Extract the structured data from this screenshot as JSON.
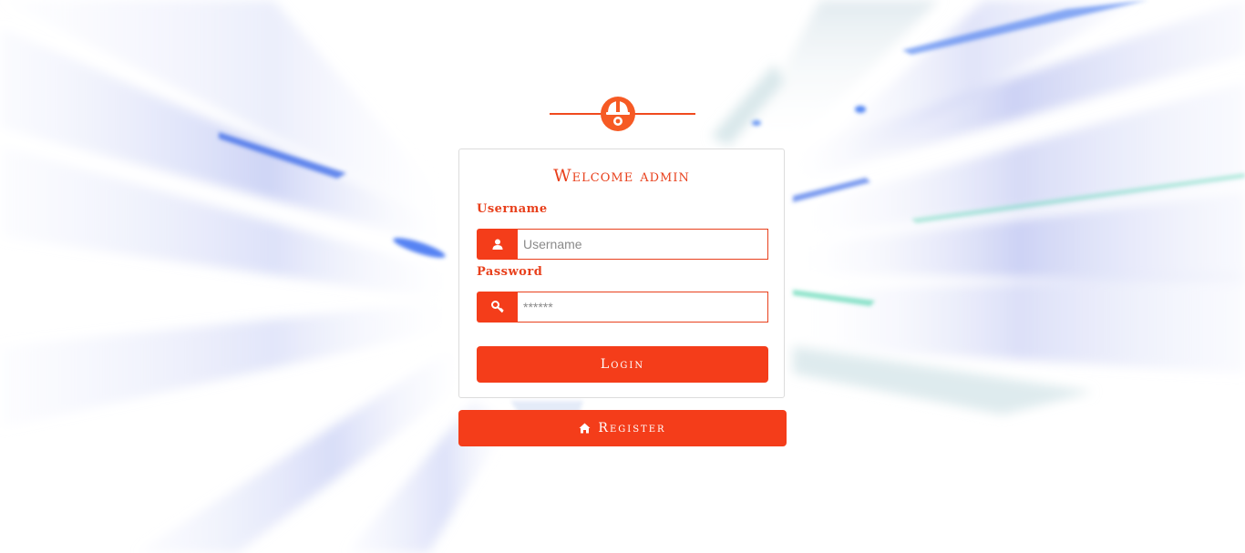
{
  "colors": {
    "accent": "#f43d1a",
    "accent_text": "#e8401c"
  },
  "header": {
    "logo_icon": "helmet-gear-icon"
  },
  "login_card": {
    "title": "Welcome admin",
    "username_label": "Username",
    "username_placeholder": "Username",
    "username_icon": "user-icon",
    "password_label": "Password",
    "password_placeholder": "******",
    "password_icon": "key-icon",
    "login_button": "Login"
  },
  "register": {
    "label": "Register",
    "icon": "home-icon"
  }
}
